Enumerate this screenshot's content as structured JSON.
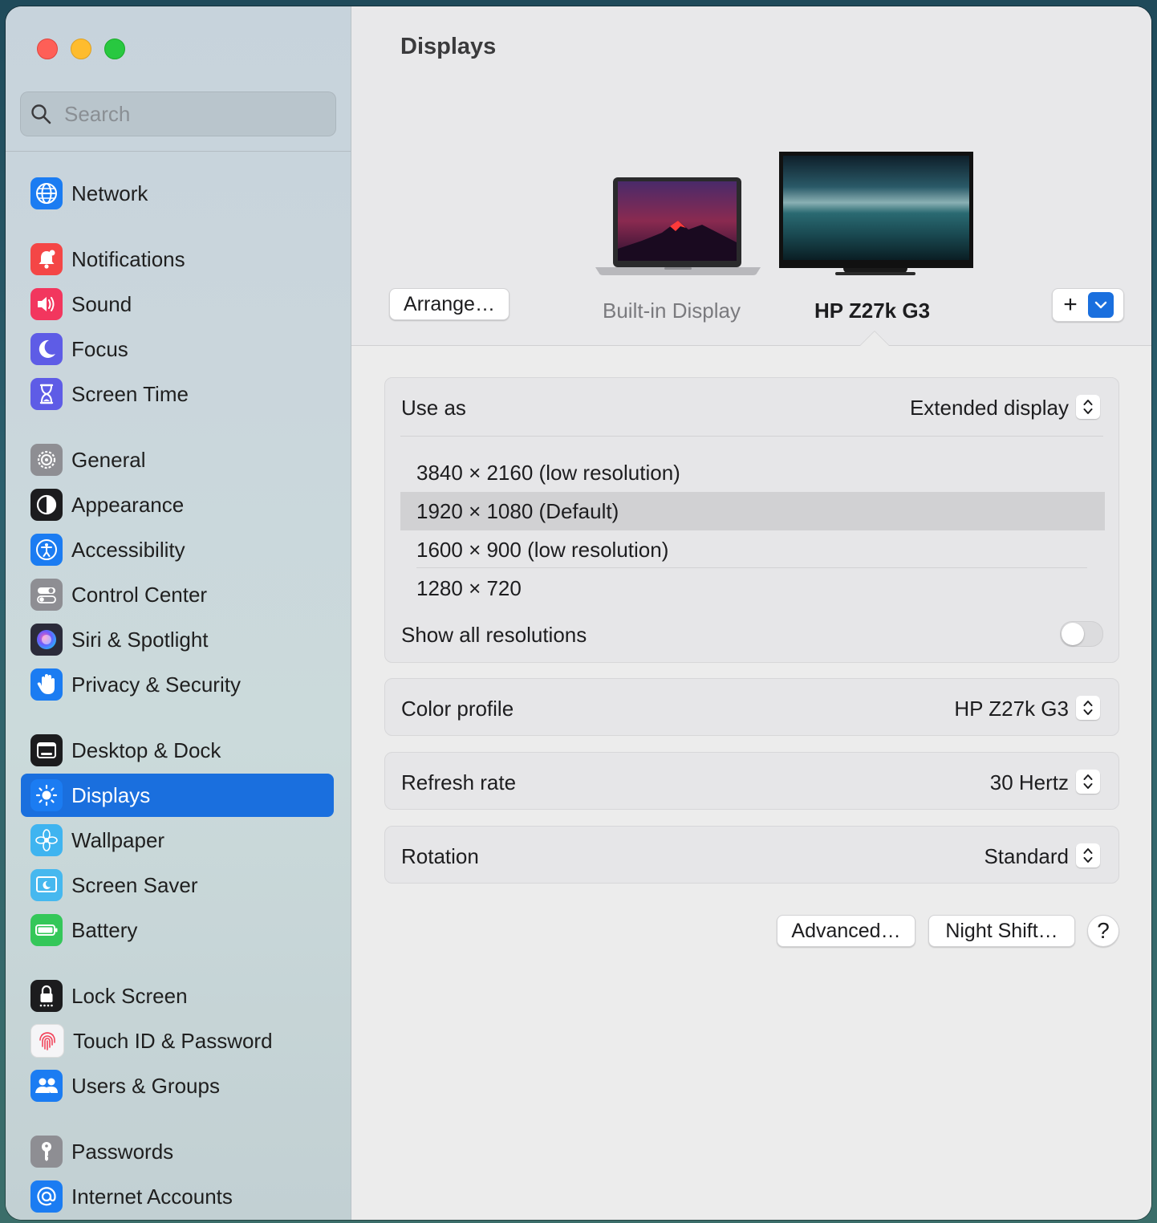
{
  "search": {
    "placeholder": "Search"
  },
  "sidebar": {
    "items": [
      {
        "label": "Network",
        "icon": "network-icon",
        "color": "#1b7cf2"
      },
      {
        "label": "Notifications",
        "icon": "bell-icon",
        "color": "#f44646"
      },
      {
        "label": "Sound",
        "icon": "speaker-icon",
        "color": "#f2365e"
      },
      {
        "label": "Focus",
        "icon": "moon-icon",
        "color": "#5e5ce6"
      },
      {
        "label": "Screen Time",
        "icon": "hourglass-icon",
        "color": "#5e5ce6"
      },
      {
        "label": "General",
        "icon": "gear-icon",
        "color": "#8e8e93"
      },
      {
        "label": "Appearance",
        "icon": "appearance-icon",
        "color": "#1c1c1e"
      },
      {
        "label": "Accessibility",
        "icon": "accessibility-icon",
        "color": "#1b7cf2"
      },
      {
        "label": "Control Center",
        "icon": "toggles-icon",
        "color": "#8e8e93"
      },
      {
        "label": "Siri & Spotlight",
        "icon": "siri-icon",
        "color": "#2b2b3a"
      },
      {
        "label": "Privacy & Security",
        "icon": "hand-icon",
        "color": "#1b7cf2"
      },
      {
        "label": "Desktop & Dock",
        "icon": "dock-icon",
        "color": "#1c1c1e"
      },
      {
        "label": "Displays",
        "icon": "sun-icon",
        "color": "#1b7cf2"
      },
      {
        "label": "Wallpaper",
        "icon": "flower-icon",
        "color": "#3fb4f0"
      },
      {
        "label": "Screen Saver",
        "icon": "screensaver-icon",
        "color": "#46b8ef"
      },
      {
        "label": "Battery",
        "icon": "battery-icon",
        "color": "#34c759"
      },
      {
        "label": "Lock Screen",
        "icon": "lock-icon",
        "color": "#1c1c1e"
      },
      {
        "label": "Touch ID & Password",
        "icon": "fingerprint-icon",
        "color": "#f5f5f7"
      },
      {
        "label": "Users & Groups",
        "icon": "users-icon",
        "color": "#1b7cf2"
      },
      {
        "label": "Passwords",
        "icon": "key-icon",
        "color": "#8e8e93"
      },
      {
        "label": "Internet Accounts",
        "icon": "at-icon",
        "color": "#1b7cf2"
      }
    ],
    "active": "Displays"
  },
  "main": {
    "title": "Displays",
    "arrange_label": "Arrange…",
    "displays": [
      {
        "label": "Built-in Display",
        "selected": false
      },
      {
        "label": "HP Z27k G3",
        "selected": true
      }
    ],
    "add_label": "+",
    "use_as": {
      "label": "Use as",
      "value": "Extended display"
    },
    "resolutions": [
      {
        "label": "3840 × 2160 (low resolution)",
        "selected": false
      },
      {
        "label": "1920 × 1080 (Default)",
        "selected": true
      },
      {
        "label": "1600 × 900 (low resolution)",
        "selected": false
      },
      {
        "label": "1280 × 720",
        "selected": false
      }
    ],
    "show_all": {
      "label": "Show all resolutions",
      "on": false
    },
    "color_profile": {
      "label": "Color profile",
      "value": "HP Z27k G3"
    },
    "refresh_rate": {
      "label": "Refresh rate",
      "value": "30 Hertz"
    },
    "rotation": {
      "label": "Rotation",
      "value": "Standard"
    },
    "advanced_label": "Advanced…",
    "night_shift_label": "Night Shift…",
    "help_label": "?"
  },
  "colors": {
    "accent": "#1a6fde",
    "selection": "#d1d1d3"
  }
}
